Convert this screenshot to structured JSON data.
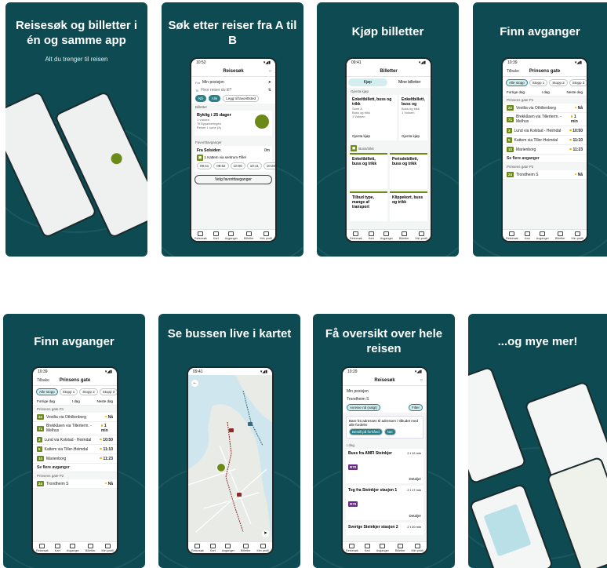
{
  "cards": [
    {
      "headline": "Reisesøk og billetter i én og samme app",
      "sub": "Alt du trenger til reisen"
    },
    {
      "headline": "Søk etter reiser fra A til B",
      "phone": {
        "time": "10:52",
        "title": "Reisesøk",
        "from_label": "Fra",
        "from": "Min posisjon",
        "to_label": "Til",
        "to": "Hvor reiser du til?",
        "chips": [
          "Nå",
          "Alle"
        ],
        "add_chip": "Legg til favorittsted",
        "tickets_title": "Billetter",
        "ticket_name": "Byklig i 25 dager",
        "ticket_lines": [
          "1 voksen",
          "Til Byparkeringen",
          "Reiser 1 sone (A)"
        ],
        "fav_title": "Favorittavganger",
        "fav_from": "Fra Solsiden",
        "fav_dist": "0m",
        "fav_line": "1 Kattem via sentrum-Tiller",
        "fav_times": [
          "09:41",
          "09:52",
          "10:00",
          "10:11",
          "10:20"
        ],
        "fav_button": "Velg favorittavganger"
      }
    },
    {
      "headline": "Kjøp billetter",
      "phone": {
        "time": "09:41",
        "title": "Billetter",
        "tabs": [
          "Kjøp",
          "Mine billetter"
        ],
        "recent_title": "Gjenta kjøp",
        "recent": [
          {
            "name": "Enkeltbillett, buss og trikk",
            "meta": [
              "Sone A",
              "Buss og trikk",
              "1 Voksen"
            ],
            "cta": "Gjenta kjøp"
          },
          {
            "name": "Enkeltbillett, buss og trikk",
            "meta": [
              "Buss og trikk",
              "1 Voksen"
            ],
            "cta": "Gjenta kjøp"
          }
        ],
        "new_title": "Buss/trikk",
        "products": [
          "Enkeltbillett, buss og trikk",
          "Periodebillett, buss og trikk",
          "Tilbud type, mange af transport",
          "Klippekort, buss og trikk"
        ]
      }
    },
    {
      "headline": "Finn avganger",
      "phone": {
        "time": "10:39",
        "back": "Tilbake",
        "title": "Prinsens gate",
        "filters": [
          "Alle stopp",
          "Stopp 1",
          "Stopp 2",
          "Stopp 3"
        ],
        "prev": "Forrige dag",
        "day": "I dag",
        "next": "Neste dag",
        "quay1": "Prinsens gate P1",
        "departures": [
          {
            "line": "22",
            "dest": "Vestlia via Othilienborg",
            "time": "Nå"
          },
          {
            "line": "71",
            "dest": "Brekkåsen via Tillerterm. - Melhus",
            "time": "1 min"
          },
          {
            "line": "3",
            "dest": "Lund via Kolstad - Heimdal",
            "time": "10:50"
          },
          {
            "line": "5",
            "dest": "Kattem via Tiller-Heimdal",
            "time": "11:10"
          },
          {
            "line": "10",
            "dest": "Marienborg",
            "time": "11:23"
          }
        ],
        "more": "Se flere avganger",
        "quay2": "Prinsens gate P2",
        "last": {
          "line": "24",
          "dest": "Trondheim S",
          "time": "Nå"
        }
      }
    },
    {
      "headline": "Finn avganger"
    },
    {
      "headline": "Se bussen live i kartet",
      "phone": {
        "time": "09:41"
      }
    },
    {
      "headline": "Få oversikt over hele reisen",
      "phone": {
        "time": "10:29",
        "title": "Reisesøk",
        "from": "Min posisjon",
        "to": "Trondheim S",
        "filter": "Avreise nå (valgt)",
        "filter_btn": "Filter",
        "notice": "Bare fra adressen til adressen i tilbudet med alle fordeler",
        "notice_btns": [
          "Bestill på forhånd",
          "Nei"
        ],
        "day": "I dag",
        "trips": [
          {
            "title": "Buss fra AMFI Steinkjer",
            "dur": "2 t 12 min",
            "line": "R70",
            "status": "Detaljer"
          },
          {
            "title": "Tog fra Steinkjer stasjon 1",
            "dur": "2 t 17 min",
            "line": "R70",
            "status": "Detaljer"
          },
          {
            "title": "Sverige Steinkjer stasjon 2",
            "dur": "2 t 20 min"
          }
        ]
      }
    },
    {
      "headline": "...og mye mer!"
    }
  ],
  "tabbar": [
    "Reisesøk",
    "Kart",
    "Avganger",
    "Billetter",
    "Min profil"
  ]
}
